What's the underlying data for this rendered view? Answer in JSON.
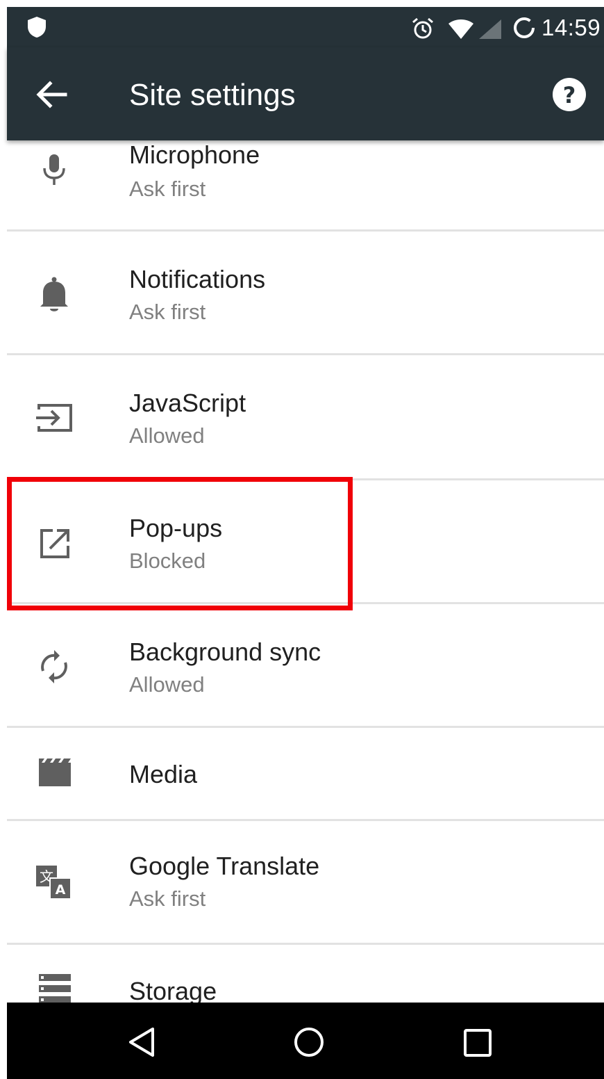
{
  "status_bar": {
    "time": "14:59",
    "icons": [
      "shield-icon",
      "alarm-icon",
      "wifi-icon",
      "signal-icon",
      "battery-icon"
    ]
  },
  "app_bar": {
    "title": "Site settings",
    "icons": [
      "back-arrow-icon",
      "help-icon"
    ]
  },
  "items": [
    {
      "title": "Microphone",
      "subtitle": "Ask first",
      "icon": "microphone-icon"
    },
    {
      "title": "Notifications",
      "subtitle": "Ask first",
      "icon": "bell-icon"
    },
    {
      "title": "JavaScript",
      "subtitle": "Allowed",
      "icon": "javascript-icon"
    },
    {
      "title": "Pop-ups",
      "subtitle": "Blocked",
      "icon": "popup-open-icon"
    },
    {
      "title": "Background sync",
      "subtitle": "Allowed",
      "icon": "sync-icon"
    },
    {
      "title": "Media",
      "icon": "clapperboard-icon"
    },
    {
      "title": "Google Translate",
      "subtitle": "Ask first",
      "icon": "translate-icon"
    },
    {
      "title": "Storage",
      "icon": "storage-icon"
    }
  ],
  "highlight": {
    "target": "Pop-ups",
    "color": "#f00008"
  },
  "nav_bar": {
    "icons": [
      "nav-back-icon",
      "nav-home-icon",
      "nav-recents-icon"
    ]
  },
  "colors": {
    "toolbar": "#263238",
    "primary_text": "#202020",
    "secondary_text": "#808080",
    "divider": "#e2e2e2"
  }
}
